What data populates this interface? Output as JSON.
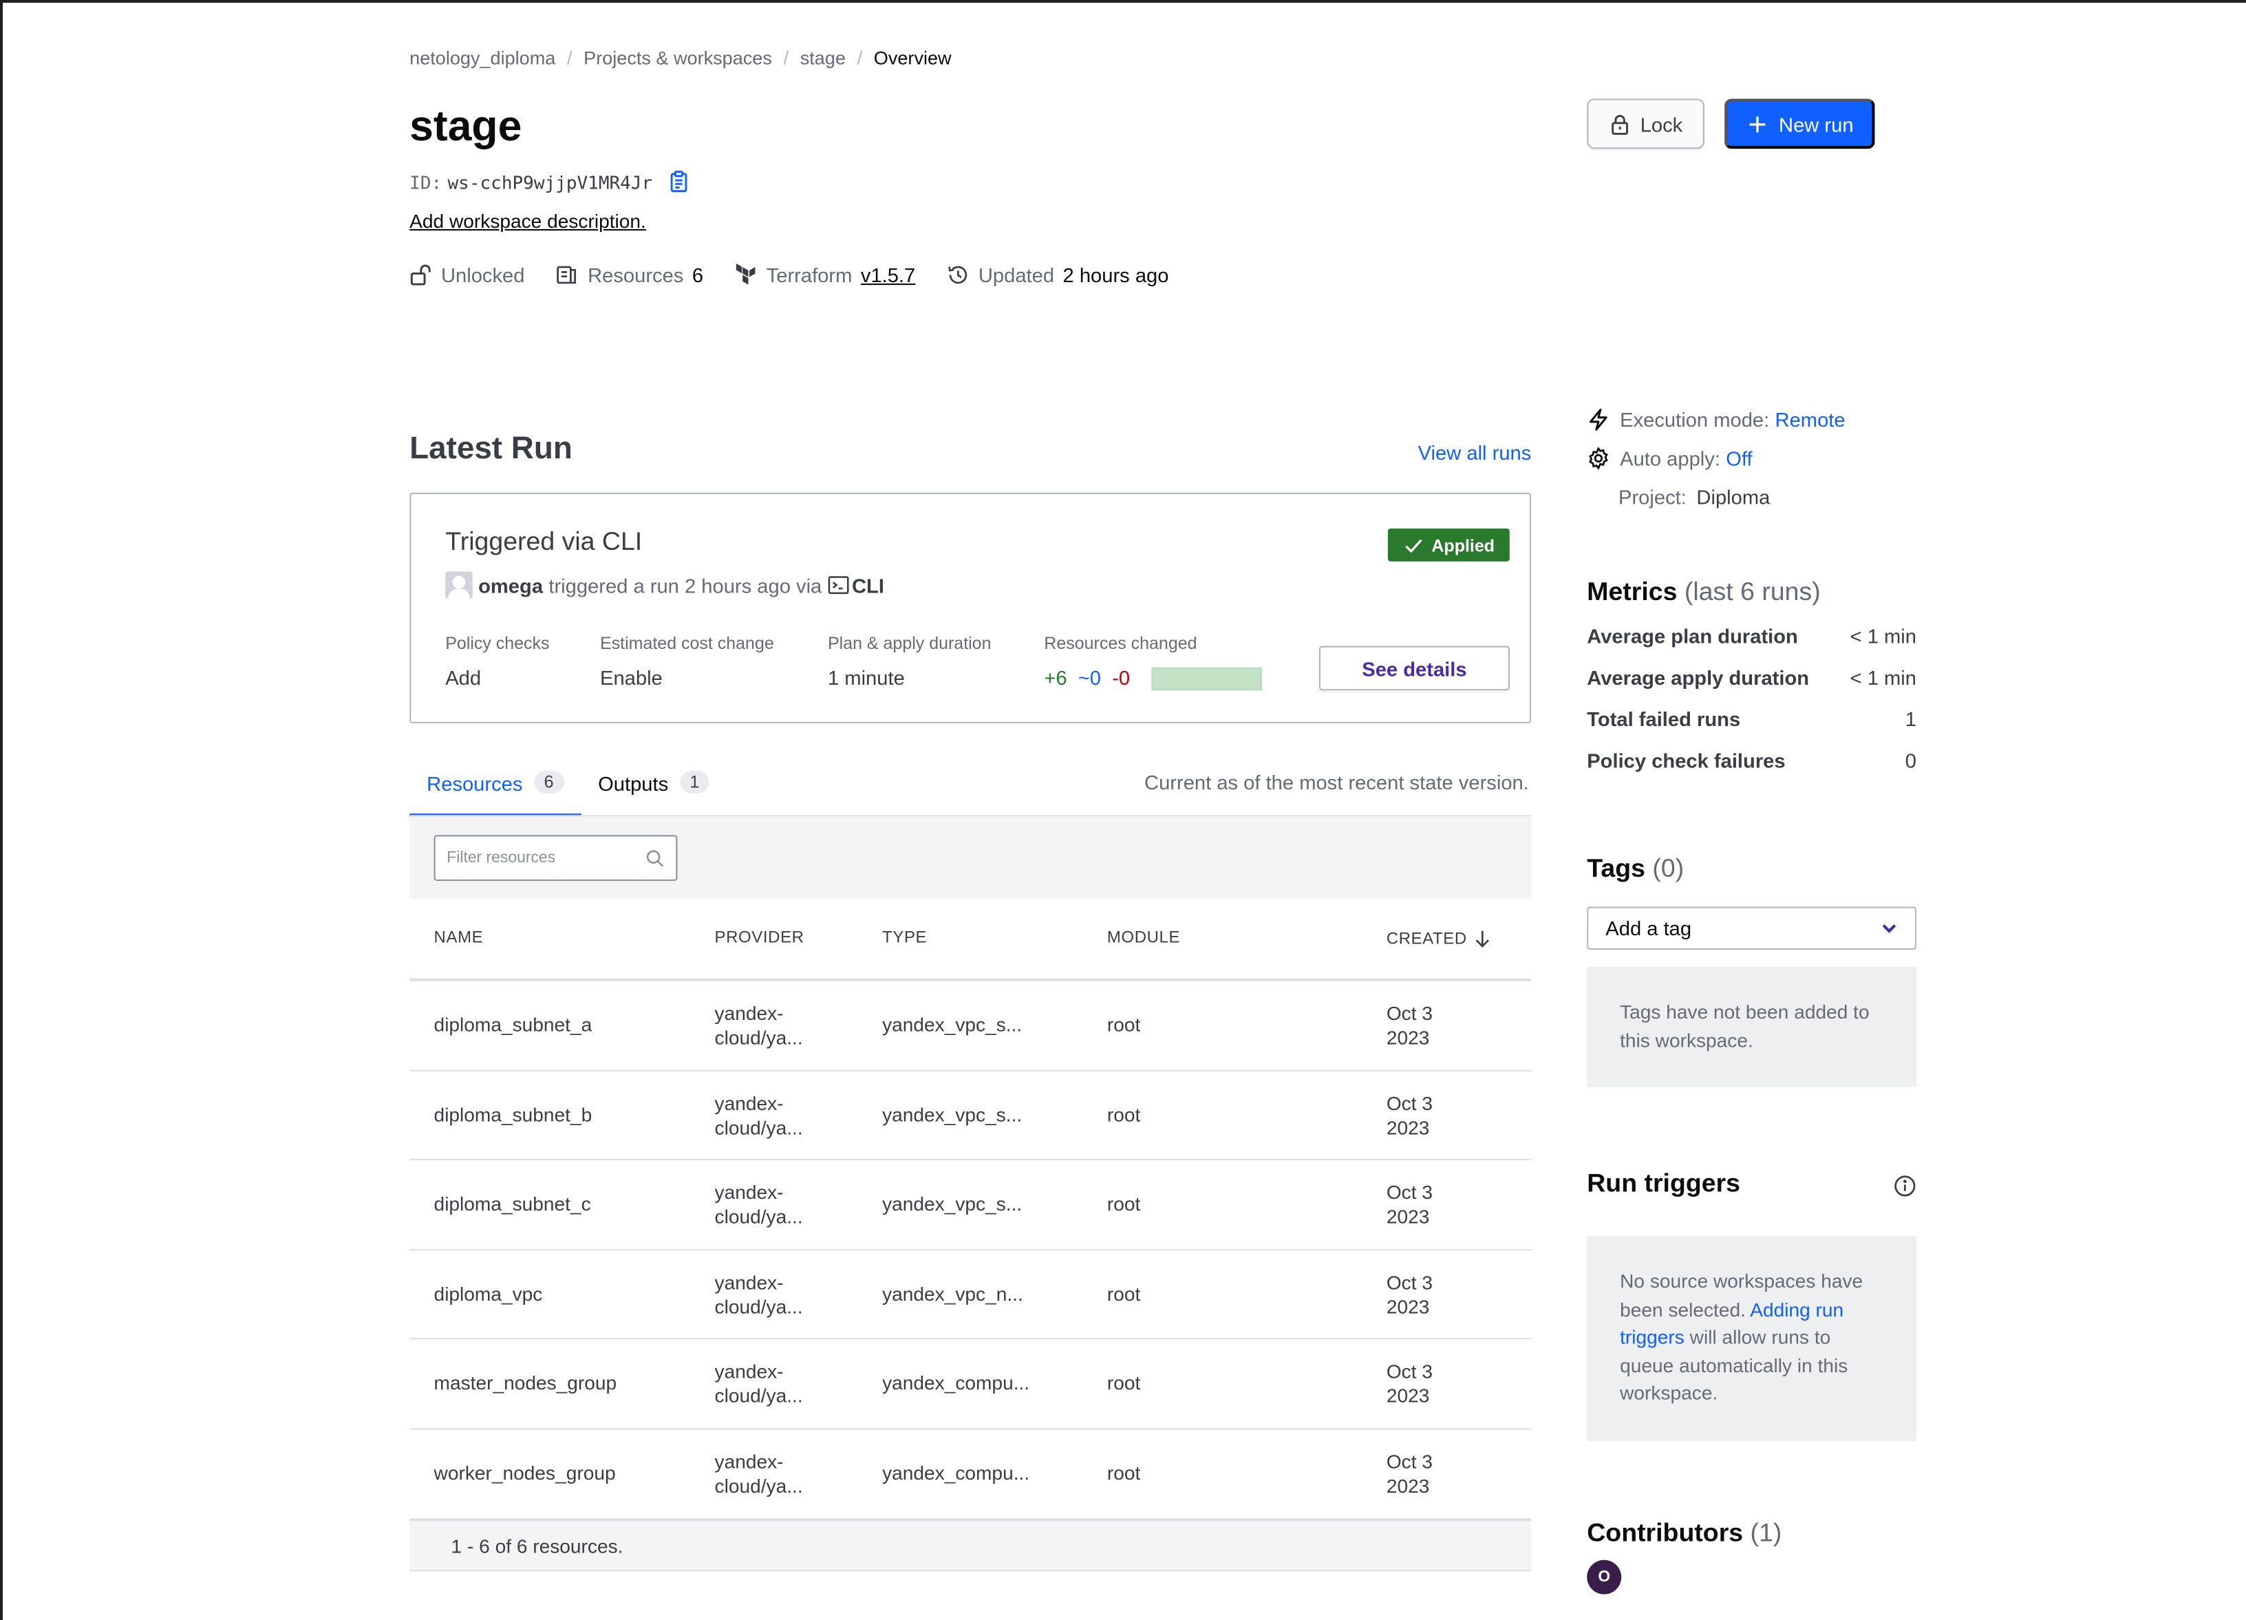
{
  "breadcrumb": [
    "netology_diploma",
    "Projects & workspaces",
    "stage",
    "Overview"
  ],
  "workspace": {
    "name": "stage",
    "id_label": "ID:",
    "id": "ws-cchP9wjjpV1MR4Jr",
    "add_description": "Add workspace description.",
    "lock_status": "Unlocked",
    "resources_label": "Resources",
    "resources_count": "6",
    "terraform_label": "Terraform",
    "terraform_version": "v1.5.7",
    "updated_label": "Updated",
    "updated_value": "2 hours ago"
  },
  "actions": {
    "lock": "Lock",
    "new_run": "New run"
  },
  "latest_run": {
    "heading": "Latest Run",
    "view_all": "View all runs",
    "title": "Triggered via CLI",
    "status": "Applied",
    "user": "omega",
    "trigger_text": "triggered a run 2 hours ago via",
    "via": "CLI",
    "policy_checks_label": "Policy checks",
    "policy_checks_value": "Add",
    "cost_label": "Estimated cost change",
    "cost_value": "Enable",
    "duration_label": "Plan & apply duration",
    "duration_value": "1 minute",
    "changed_label": "Resources changed",
    "added": "+6",
    "changed": "~0",
    "destroyed": "-0",
    "details_button": "See details"
  },
  "tabs": [
    {
      "label": "Resources",
      "count": "6"
    },
    {
      "label": "Outputs",
      "count": "1"
    }
  ],
  "state_note": "Current as of the most recent state version.",
  "filter_placeholder": "Filter resources",
  "table": {
    "headers": [
      "NAME",
      "PROVIDER",
      "TYPE",
      "MODULE",
      "CREATED"
    ],
    "rows": [
      {
        "name": "diploma_subnet_a",
        "provider1": "yandex-",
        "provider2": "cloud/ya...",
        "type": "yandex_vpc_s...",
        "module": "root",
        "created1": "Oct 3",
        "created2": "2023"
      },
      {
        "name": "diploma_subnet_b",
        "provider1": "yandex-",
        "provider2": "cloud/ya...",
        "type": "yandex_vpc_s...",
        "module": "root",
        "created1": "Oct 3",
        "created2": "2023"
      },
      {
        "name": "diploma_subnet_c",
        "provider1": "yandex-",
        "provider2": "cloud/ya...",
        "type": "yandex_vpc_s...",
        "module": "root",
        "created1": "Oct 3",
        "created2": "2023"
      },
      {
        "name": "diploma_vpc",
        "provider1": "yandex-",
        "provider2": "cloud/ya...",
        "type": "yandex_vpc_n...",
        "module": "root",
        "created1": "Oct 3",
        "created2": "2023"
      },
      {
        "name": "master_nodes_group",
        "provider1": "yandex-",
        "provider2": "cloud/ya...",
        "type": "yandex_compu...",
        "module": "root",
        "created1": "Oct 3",
        "created2": "2023"
      },
      {
        "name": "worker_nodes_group",
        "provider1": "yandex-",
        "provider2": "cloud/ya...",
        "type": "yandex_compu...",
        "module": "root",
        "created1": "Oct 3",
        "created2": "2023"
      }
    ],
    "footer": "1 - 6 of 6 resources."
  },
  "sidebar": {
    "execution_mode_label": "Execution mode:",
    "execution_mode": "Remote",
    "auto_apply_label": "Auto apply:",
    "auto_apply": "Off",
    "project_label": "Project:",
    "project": "Diploma",
    "metrics_title": "Metrics",
    "metrics_sub": "(last 6 runs)",
    "metrics": [
      {
        "label": "Average plan duration",
        "value": "< 1 min"
      },
      {
        "label": "Average apply duration",
        "value": "< 1 min"
      },
      {
        "label": "Total failed runs",
        "value": "1"
      },
      {
        "label": "Policy check failures",
        "value": "0"
      }
    ],
    "tags_title": "Tags",
    "tags_count": "(0)",
    "tag_select": "Add a tag",
    "tags_empty": "Tags have not been added to this workspace.",
    "run_triggers_title": "Run triggers",
    "rt_text1": "No source workspaces have been selected.",
    "rt_link": "Adding run triggers",
    "rt_text2": "will allow runs to queue automatically in this workspace.",
    "contributors_title": "Contributors",
    "contributors_count": "(1)",
    "contributor_initial": "O"
  },
  "colors": {
    "primary": "#1060ff",
    "applied": "#2a7a2e",
    "details_text": "#4b2aa6",
    "avatar": "#3b1d4a"
  },
  "icons": [
    "copy-icon",
    "unlock-icon",
    "resources-icon",
    "terraform-icon",
    "history-icon",
    "lock-icon",
    "plus-icon",
    "check-icon",
    "terminal-icon",
    "search-icon",
    "arrow-down-icon",
    "bolt-icon",
    "gear-icon",
    "chevron-down-icon",
    "info-icon"
  ]
}
